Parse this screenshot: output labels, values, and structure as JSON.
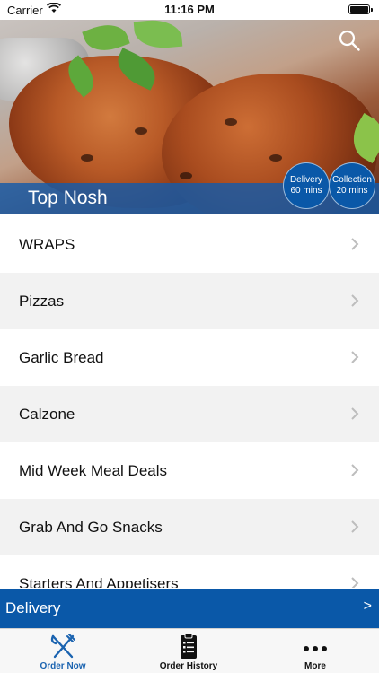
{
  "status_bar": {
    "carrier": "Carrier",
    "time": "11:16 PM"
  },
  "hero": {
    "restaurant_name": "Top Nosh",
    "delivery_badge": {
      "label": "Delivery",
      "time": "60 mins"
    },
    "collection_badge": {
      "label": "Collection",
      "time": "20 mins"
    }
  },
  "menu": {
    "categories": [
      {
        "label": "WRAPS"
      },
      {
        "label": "Pizzas"
      },
      {
        "label": "Garlic Bread"
      },
      {
        "label": "Calzone"
      },
      {
        "label": "Mid Week Meal Deals"
      },
      {
        "label": "Grab And Go Snacks"
      },
      {
        "label": "Starters And Appetisers"
      }
    ]
  },
  "delivery_bar": {
    "label": "Delivery",
    "arrow": ">"
  },
  "tab_bar": {
    "tabs": [
      {
        "label": "Order Now",
        "icon": "fork-knife-icon",
        "active": true
      },
      {
        "label": "Order History",
        "icon": "clipboard-list-icon",
        "active": false
      },
      {
        "label": "More",
        "icon": "more-dots-icon",
        "active": false
      }
    ]
  },
  "colors": {
    "primary_blue": "#0a58a8",
    "active_tab": "#1a63b0",
    "row_alt": "#f2f2f2"
  }
}
